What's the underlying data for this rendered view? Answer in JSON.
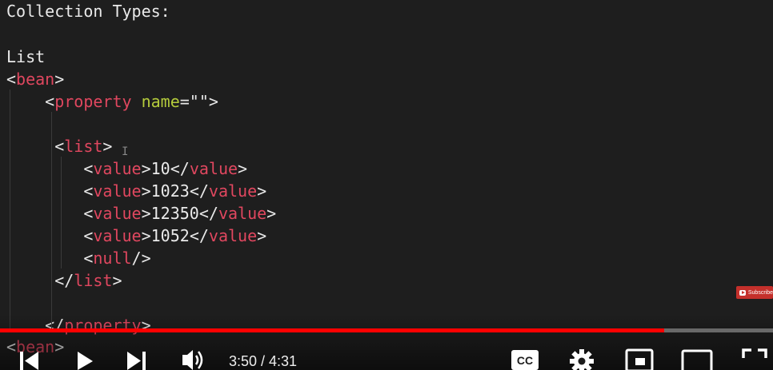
{
  "code_lines": [
    {
      "tokens": [
        {
          "c": "tx",
          "t": "Collection Types:"
        }
      ]
    },
    {
      "tokens": []
    },
    {
      "tokens": [
        {
          "c": "tx",
          "t": "List"
        }
      ]
    },
    {
      "tokens": [
        {
          "c": "br",
          "t": "<"
        },
        {
          "c": "tg",
          "t": "bean"
        },
        {
          "c": "br",
          "t": ">"
        }
      ]
    },
    {
      "tokens": [
        {
          "c": "br",
          "t": "    <"
        },
        {
          "c": "tg",
          "t": "property"
        },
        {
          "c": "tx",
          "t": " "
        },
        {
          "c": "at",
          "t": "name"
        },
        {
          "c": "br",
          "t": "=\"\">"
        }
      ]
    },
    {
      "tokens": []
    },
    {
      "tokens": [
        {
          "c": "br",
          "t": "     <"
        },
        {
          "c": "tg",
          "t": "list"
        },
        {
          "c": "br",
          "t": ">"
        }
      ]
    },
    {
      "tokens": [
        {
          "c": "br",
          "t": "        <"
        },
        {
          "c": "tg",
          "t": "value"
        },
        {
          "c": "br",
          "t": ">"
        },
        {
          "c": "tx",
          "t": "10"
        },
        {
          "c": "br",
          "t": "</"
        },
        {
          "c": "tg",
          "t": "value"
        },
        {
          "c": "br",
          "t": ">"
        }
      ]
    },
    {
      "tokens": [
        {
          "c": "br",
          "t": "        <"
        },
        {
          "c": "tg",
          "t": "value"
        },
        {
          "c": "br",
          "t": ">"
        },
        {
          "c": "tx",
          "t": "1023"
        },
        {
          "c": "br",
          "t": "</"
        },
        {
          "c": "tg",
          "t": "value"
        },
        {
          "c": "br",
          "t": ">"
        }
      ]
    },
    {
      "tokens": [
        {
          "c": "br",
          "t": "        <"
        },
        {
          "c": "tg",
          "t": "value"
        },
        {
          "c": "br",
          "t": ">"
        },
        {
          "c": "tx",
          "t": "12350"
        },
        {
          "c": "br",
          "t": "</"
        },
        {
          "c": "tg",
          "t": "value"
        },
        {
          "c": "br",
          "t": ">"
        }
      ]
    },
    {
      "tokens": [
        {
          "c": "br",
          "t": "        <"
        },
        {
          "c": "tg",
          "t": "value"
        },
        {
          "c": "br",
          "t": ">"
        },
        {
          "c": "tx",
          "t": "1052"
        },
        {
          "c": "br",
          "t": "</"
        },
        {
          "c": "tg",
          "t": "value"
        },
        {
          "c": "br",
          "t": ">"
        }
      ]
    },
    {
      "tokens": [
        {
          "c": "br",
          "t": "        <"
        },
        {
          "c": "tg",
          "t": "null"
        },
        {
          "c": "br",
          "t": "/>"
        }
      ]
    },
    {
      "tokens": [
        {
          "c": "br",
          "t": "     </"
        },
        {
          "c": "tg",
          "t": "list"
        },
        {
          "c": "br",
          "t": ">"
        }
      ]
    },
    {
      "tokens": []
    },
    {
      "tokens": [
        {
          "c": "br",
          "t": "    </"
        },
        {
          "c": "tg",
          "t": "property"
        },
        {
          "c": "br",
          "t": ">"
        }
      ]
    },
    {
      "tokens": [
        {
          "c": "br",
          "t": "<"
        },
        {
          "c": "tg",
          "t": "bean"
        },
        {
          "c": "br",
          "t": ">"
        }
      ]
    }
  ],
  "subscribe": {
    "label": "Subscribe"
  },
  "player": {
    "time_current": "3:50",
    "time_total": "4:31",
    "time_display": "3:50 / 4:31",
    "progress_fraction": 0.859,
    "colors": {
      "played": "#ff0000",
      "tag": "#e0475f",
      "attr": "#b5cc3c"
    }
  },
  "controls": {
    "prev": "previous-icon",
    "play": "play-icon",
    "next": "next-icon",
    "volume": "volume-icon",
    "cc": "CC",
    "settings": "gear-icon",
    "miniplayer": "miniplayer-icon",
    "theater": "theater-icon",
    "fullscreen": "fullscreen-icon"
  }
}
